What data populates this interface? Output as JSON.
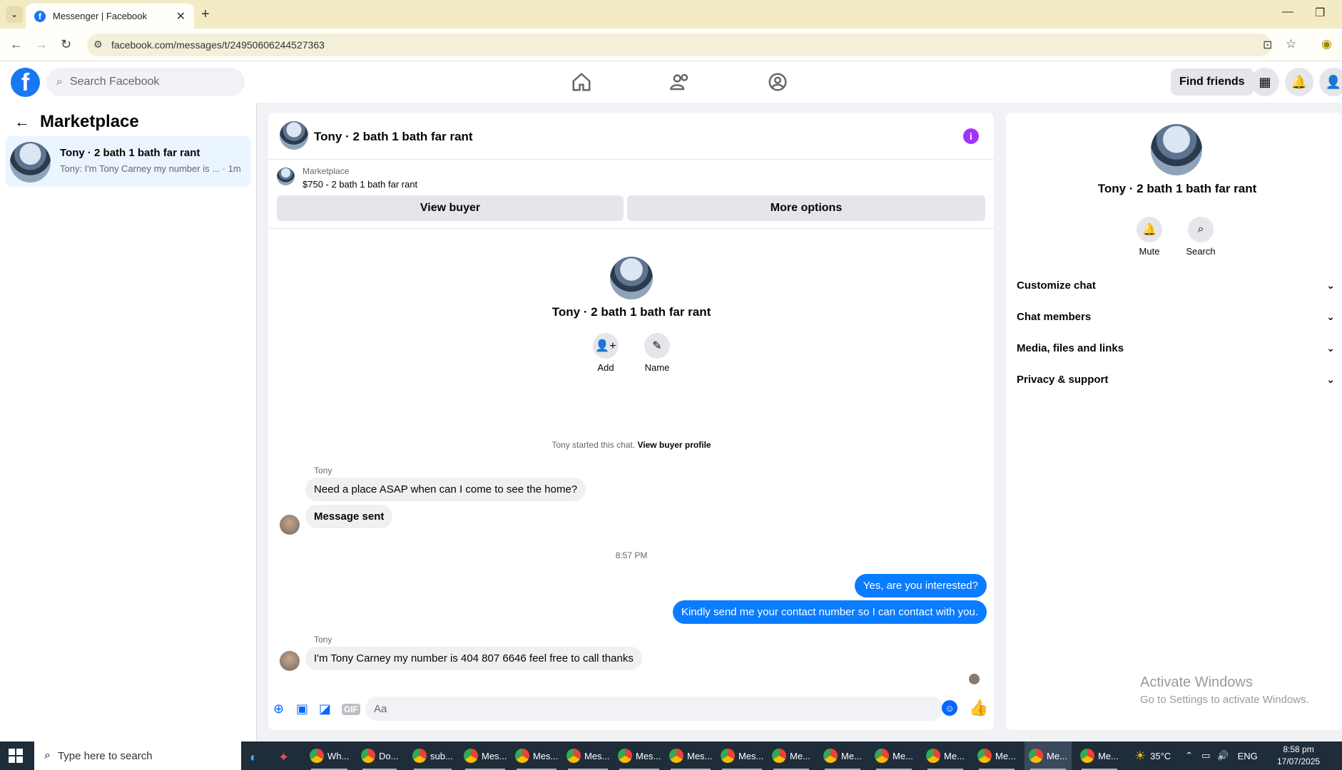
{
  "browser": {
    "tab_title": "Messenger | Facebook",
    "url": "facebook.com/messages/t/24950606244527363"
  },
  "fbnav": {
    "search_placeholder": "Search Facebook",
    "find_friends": "Find friends"
  },
  "sidebar": {
    "title": "Marketplace",
    "conversation": {
      "name": "Tony · 2 bath 1 bath far rant",
      "preview": "Tony: I'm Tony Carney my number is ...",
      "time": "· 1m"
    }
  },
  "chat": {
    "header_name": "Tony · 2 bath 1 bath far rant",
    "listing_label": "Marketplace",
    "listing_price": "$750 - 2 bath 1 bath far rant",
    "view_buyer": "View buyer",
    "more_options": "More options",
    "intro_name": "Tony · 2 bath 1 bath far rant",
    "add_label": "Add",
    "name_label": "Name",
    "started_text": "Tony started this chat.",
    "view_buyer_profile": "View buyer profile",
    "messages": [
      {
        "sender": "Tony",
        "text": "Need a place ASAP when can I come to see the home?"
      },
      {
        "text": "Message sent"
      },
      {
        "timestamp": "8:57 PM"
      },
      {
        "text": "Yes, are you interested?"
      },
      {
        "text": "Kindly send me your contact number so I can contact with you."
      },
      {
        "sender": "Tony",
        "text": "I'm Tony Carney my number is 404 807 6646 feel free to call thanks"
      }
    ],
    "composer_placeholder": "Aa"
  },
  "right_panel": {
    "name": "Tony · 2 bath 1 bath far rant",
    "mute": "Mute",
    "search": "Search",
    "sections": [
      "Customize chat",
      "Chat members",
      "Media, files and links",
      "Privacy & support"
    ]
  },
  "watermark": {
    "line1": "Activate Windows",
    "line2": "Go to Settings to activate Windows."
  },
  "taskbar": {
    "search_placeholder": "Type here to search",
    "apps": [
      "Wh...",
      "Do...",
      "sub...",
      "Mes...",
      "Mes...",
      "Mes...",
      "Mes...",
      "Mes...",
      "Mes...",
      "Me...",
      "Me...",
      "Me...",
      "Me...",
      "Me...",
      "Me...",
      "Me..."
    ],
    "weather": "35°C",
    "lang": "ENG",
    "time": "8:58 pm",
    "date": "17/07/2025"
  },
  "colors": {
    "fb_blue": "#1877f2",
    "messenger_out": "#0a7cff",
    "info_purple": "#a033ff"
  }
}
